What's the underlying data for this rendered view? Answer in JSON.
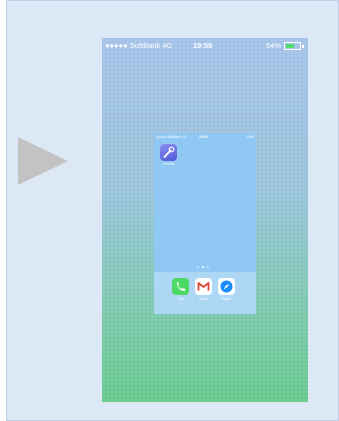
{
  "status_bar": {
    "carrier": "●●●●● SoftBank  4G",
    "time": "19:59",
    "battery": "64%",
    "battery_level": 0.64
  },
  "mini_screen": {
    "status_bar": {
      "carrier": "●●●●● SoftBank  4G",
      "time": "19:59",
      "battery": "64%"
    },
    "app": {
      "label": "Chrome",
      "icon": "wrench-icon"
    },
    "page_count": 3,
    "current_page": 2,
    "dock": [
      {
        "label": "Call",
        "icon": "phone-icon",
        "color": "#4cd964"
      },
      {
        "label": "Gmail",
        "icon": "gmail-icon",
        "color": "#ffffff"
      },
      {
        "label": "Safari",
        "icon": "compass-icon",
        "color": "#1a8cff"
      }
    ]
  },
  "colors": {
    "panel": "#dde8f6",
    "arrow": "#c3c3c3",
    "mini_bg": "#8fc8f2"
  }
}
